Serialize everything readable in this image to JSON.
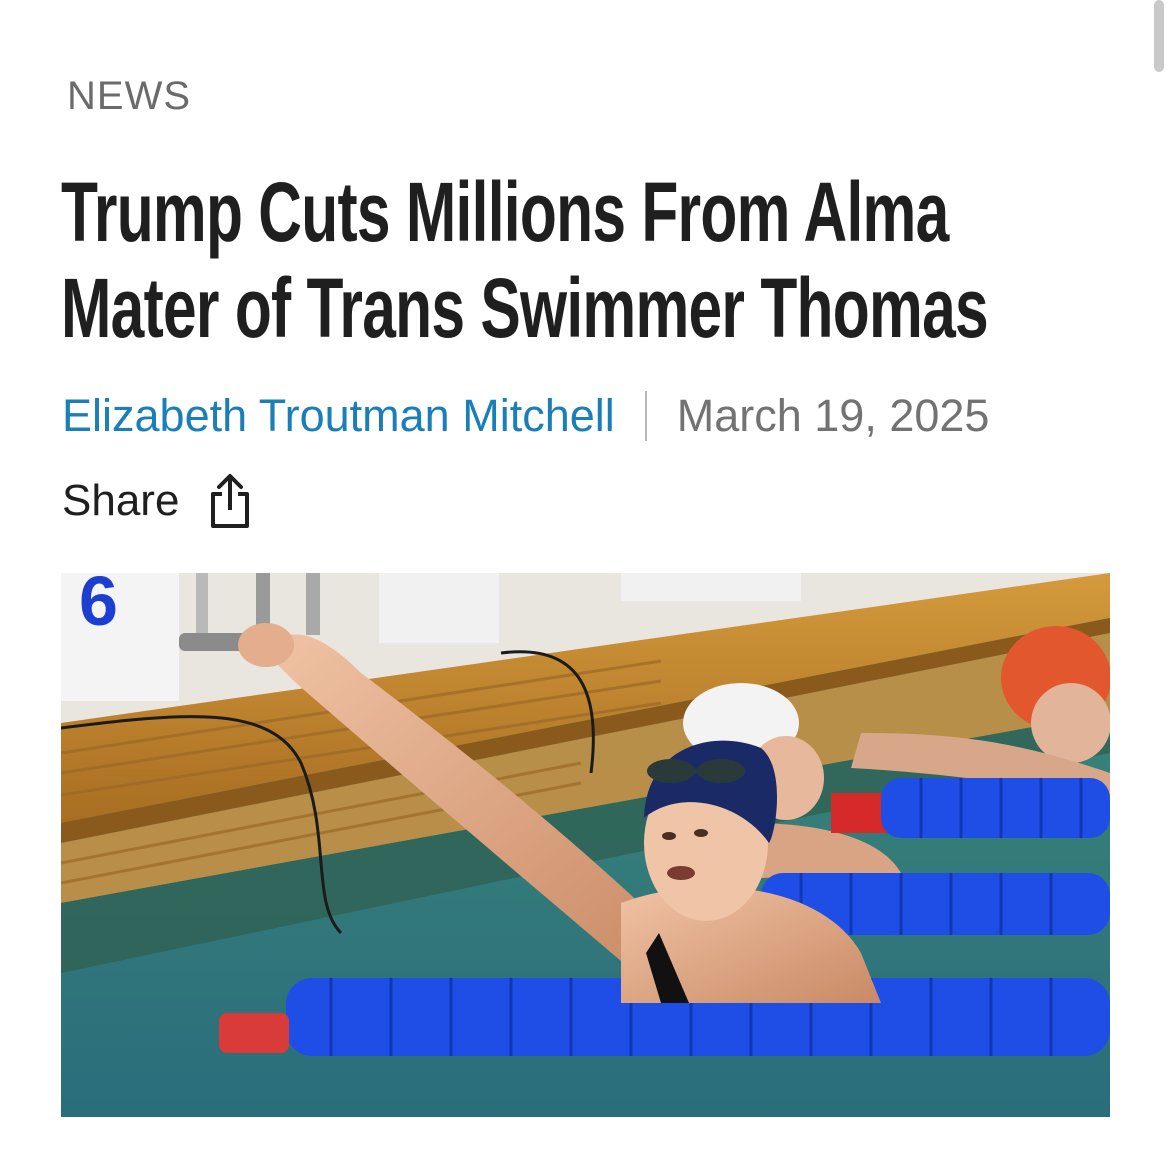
{
  "article": {
    "category": "NEWS",
    "headline_line1": "Trump Cuts Millions From Alma",
    "headline_line2": "Mater of Trans Swimmer Thomas",
    "author": "Elizabeth Troutman Mitchell",
    "date": "March 19, 2025",
    "share_label": "Share",
    "share_icon": "share-icon"
  },
  "hero": {
    "lane_marker": "6"
  },
  "colors": {
    "author_link": "#1a7fb8",
    "headline": "#1f1f1f",
    "category": "#6b6b6b",
    "date": "#727272"
  }
}
